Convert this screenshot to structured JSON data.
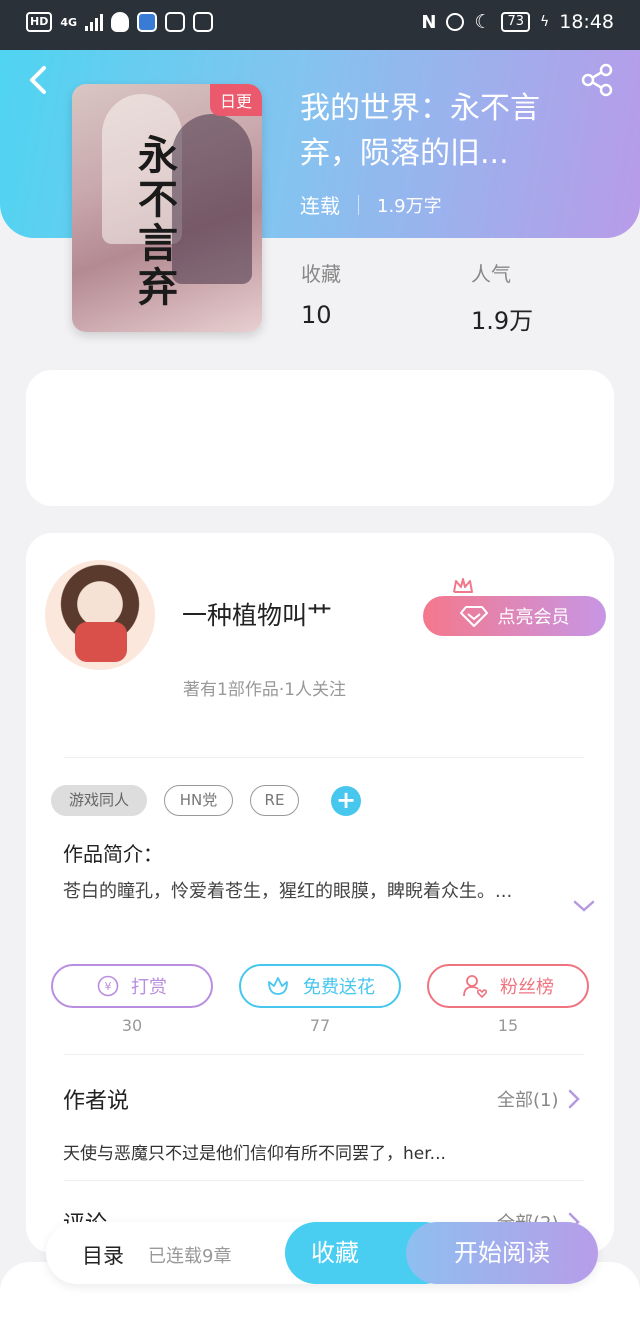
{
  "status_bar": {
    "hd": "HD",
    "network": "4G",
    "battery": "73",
    "time": "18:48"
  },
  "header": {
    "back_icon": "back-arrow-icon",
    "share_icon": "share-icon"
  },
  "book": {
    "cover_badge": "日更",
    "cover_calligraphy": [
      "永",
      "不",
      "言",
      "弃"
    ],
    "title_line1": "我的世界：永不言",
    "title_line2": "弃，陨落的旧...",
    "status": "连载",
    "words": "1.9万字",
    "stats": [
      {
        "label": "收藏",
        "value": "10"
      },
      {
        "label": "人气",
        "value": "1.9万"
      }
    ]
  },
  "author": {
    "name": "一种植物叫艹",
    "subtitle": "著有1部作品·1人关注",
    "vip_button": "点亮会员"
  },
  "tags": [
    "游戏同人",
    "HN党",
    "RE"
  ],
  "tag_add": "+",
  "intro": {
    "title": "作品简介：",
    "text": "苍白的瞳孔，怜爱着苍生，猩红的眼膜，睥睨着众生。..."
  },
  "actions": [
    {
      "label": "打赏",
      "count": "30",
      "color": "#b98ee0",
      "icon": "yen-coin-icon"
    },
    {
      "label": "免费送花",
      "count": "77",
      "color": "#47c6ee",
      "icon": "flower-icon"
    },
    {
      "label": "粉丝榜",
      "count": "15",
      "color": "#ef7480",
      "icon": "fan-user-icon"
    }
  ],
  "author_says": {
    "title": "作者说",
    "all": "全部(1)",
    "text": "天使与恶魔只不过是他们信仰有所不同罢了，her..."
  },
  "comments": {
    "title": "评论",
    "all": "全部(2)"
  },
  "bottom_bar": {
    "toc": "目录",
    "toc_sub": "已连载9章",
    "favorite": "收藏",
    "start_reading": "开始阅读"
  }
}
